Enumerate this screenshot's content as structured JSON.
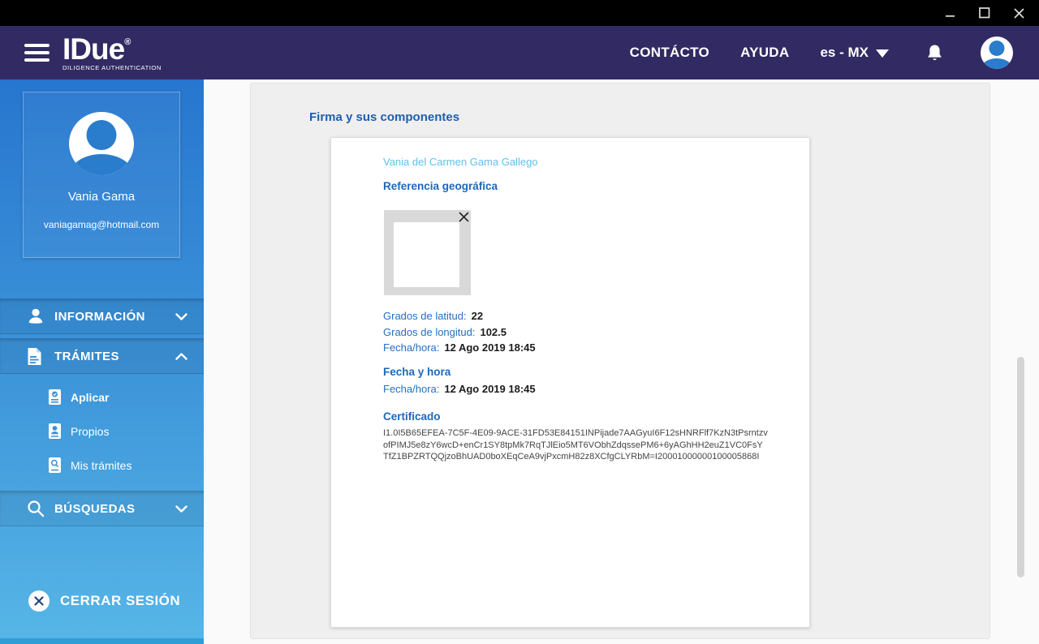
{
  "window": {
    "controls": {
      "minimize": "minimize",
      "maximize": "maximize",
      "close": "close"
    }
  },
  "header": {
    "logo": {
      "title": "IDue",
      "registered": "®",
      "subtitle": "DILIGENCE AUTHENTICATION"
    },
    "nav": {
      "contact": "CONTÁCTO",
      "help": "AYUDA",
      "language": "es - MX"
    }
  },
  "colors": {
    "titlebar_bg": "#000000",
    "header_bg": "#322a63",
    "sidebar_gradient_top": "#2776cf",
    "sidebar_gradient_bottom": "#57b6e7",
    "accent_blue": "#2470c2",
    "heading_blue": "#1d5fae",
    "signer_light_blue": "#5cc2e9",
    "avatar_blue": "#2a7ccd"
  },
  "sidebar": {
    "profile": {
      "name": "Vania Gama",
      "email": "vaniagamag@hotmail.com"
    },
    "nav": [
      {
        "label": "INFORMACIÓN",
        "expanded": false
      },
      {
        "label": "TRÁMITES",
        "expanded": true,
        "children": [
          {
            "label": "Aplicar"
          },
          {
            "label": "Propios"
          },
          {
            "label": "Mis trámites"
          }
        ]
      },
      {
        "label": "BÚSQUEDAS",
        "expanded": false
      }
    ],
    "logout_label": "CERRAR SESIÓN"
  },
  "main": {
    "section_title": "Firma y sus componentes",
    "card": {
      "signer_name": "Vania del Carmen Gama Gallego",
      "geo": {
        "title": "Referencia geográfica",
        "latitude_label": "Grados de latitud:",
        "latitude_value": "22",
        "longitude_label": "Grados de longitud:",
        "longitude_value": "102.5",
        "datetime_label": "Fecha/hora:",
        "datetime_value": "12 Ago 2019 18:45"
      },
      "datetime": {
        "title": "Fecha y hora",
        "label": "Fecha/hora:",
        "value": "12 Ago 2019 18:45"
      },
      "certificate": {
        "title": "Certificado",
        "value": "I1.0I5B65EFEA-7C5F-4E09-9ACE-31FD53E84151INPijade7AAGyuI6F12sHNRFlf7KzN3tPsrntzvofPIMJ5e8zY6wcD+enCr1SY8tpMk7RqTJlEio5MT6VObhZdqssePM6+6yAGhHH2euZ1VC0FsYTfZ1BPZRTQQjzoBhUAD0boXEqCeA9vjPxcmH82z8XCfgCLYRbM=I20001000000100005868I"
      }
    }
  }
}
